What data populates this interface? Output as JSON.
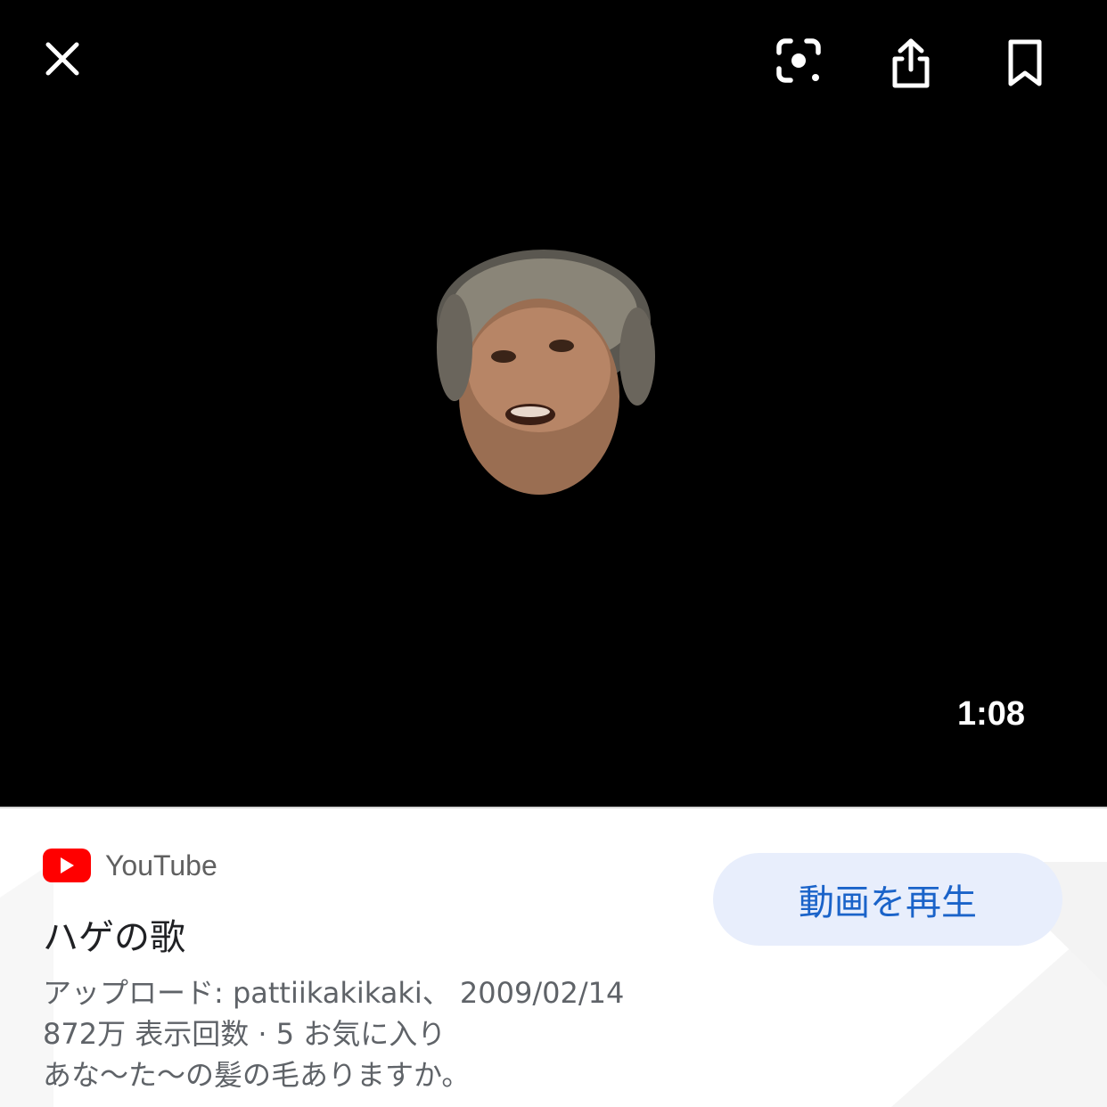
{
  "video": {
    "duration": "1:08"
  },
  "toolbar": {
    "close_icon": "close-icon",
    "lens_icon": "google-lens-icon",
    "share_icon": "share-icon",
    "bookmark_icon": "bookmark-icon"
  },
  "result": {
    "source": "YouTube",
    "title": "ハゲの歌",
    "upload_line": "アップロード: pattiikakikaki、 2009/02/14",
    "stats_line": "872万 表示回数 · 5 お気に入り",
    "description": "あな〜た〜の髪の毛ありますか。",
    "play_label": "動画を再生"
  },
  "colors": {
    "play_button_bg": "#e8eefc",
    "play_button_text": "#1a63c9",
    "youtube_red": "#ff0000"
  }
}
